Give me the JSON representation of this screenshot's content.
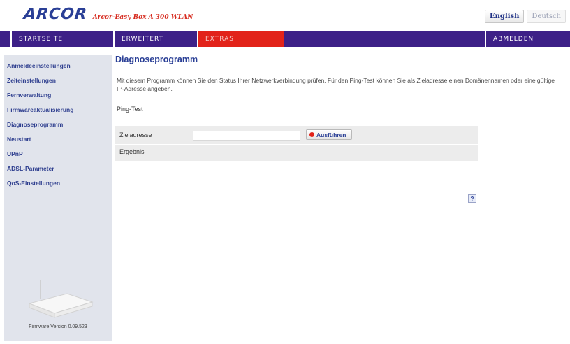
{
  "header": {
    "logo_brand": "ARCOR",
    "logo_model": "Arcor-Easy Box A 300 WLAN",
    "languages": [
      {
        "label": "English",
        "active": true
      },
      {
        "label": "Deutsch",
        "active": false
      }
    ]
  },
  "nav": {
    "startseite": "STARTSEITE",
    "erweitert": "ERWEITERT",
    "extras": "EXTRAS",
    "abmelden": "ABMELDEN"
  },
  "sidebar": {
    "items": [
      {
        "label": "Anmeldeeinstellungen"
      },
      {
        "label": "Zeiteinstellungen"
      },
      {
        "label": "Fernverwaltung"
      },
      {
        "label": "Firmwareaktualisierung"
      },
      {
        "label": "Diagnoseprogramm"
      },
      {
        "label": "Neustart"
      },
      {
        "label": "UPnP"
      },
      {
        "label": "ADSL-Parameter"
      },
      {
        "label": "QoS-Einstellungen"
      }
    ],
    "firmware": "Firmware Version 0.09.523"
  },
  "main": {
    "title": "Diagnoseprogramm",
    "description": "Mit diesem Programm können Sie den Status Ihrer Netzwerkverbindung prüfen. Für den Ping-Test können Sie als Zieladresse einen Domänennamen oder eine gültige IP-Adresse angeben.",
    "ping_label": "Ping-Test",
    "target_label": "Zieladresse",
    "target_value": "",
    "run_button": "Ausführen",
    "result_label": "Ergebnis",
    "help_glyph": "?"
  },
  "colors": {
    "nav_bg": "#3d2087",
    "nav_active": "#e2231a",
    "link": "#2f3f8f",
    "sidebar_bg": "#e1e4ec"
  },
  "icons": {
    "run": "plus-icon",
    "help": "help-icon"
  }
}
